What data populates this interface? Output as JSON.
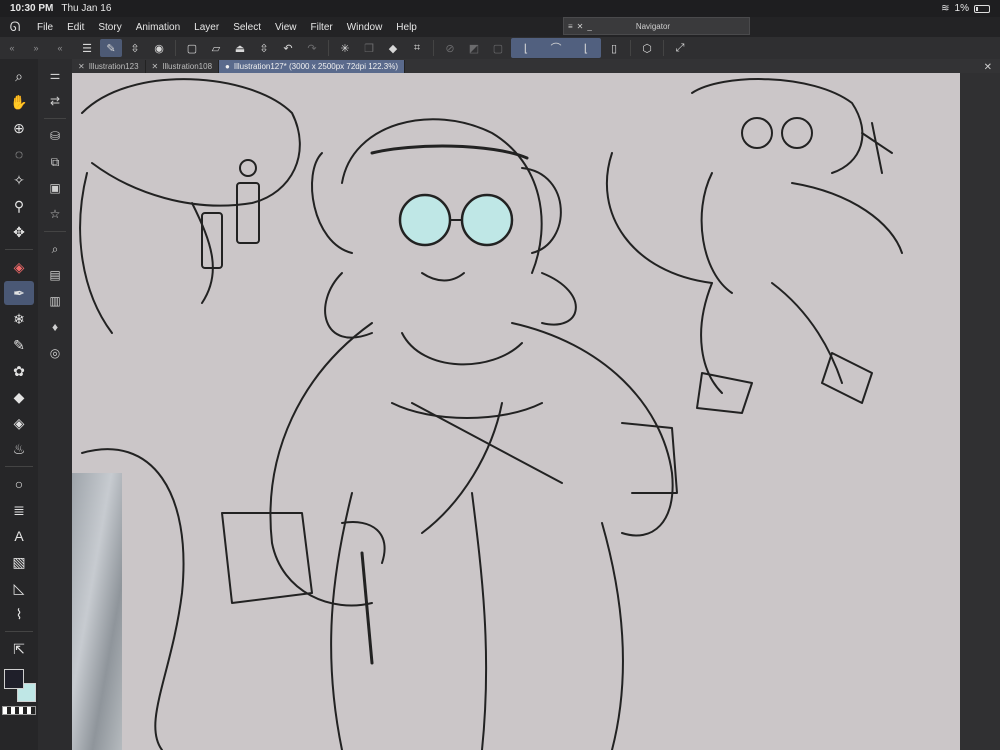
{
  "status": {
    "time": "10:30 PM",
    "date": "Thu Jan 16",
    "battery": "1%"
  },
  "menu": [
    "File",
    "Edit",
    "Story",
    "Animation",
    "Layer",
    "Select",
    "View",
    "Filter",
    "Window",
    "Help"
  ],
  "navigator": {
    "title": "Navigator"
  },
  "tabs": [
    {
      "label": "Illustration123",
      "active": false
    },
    {
      "label": "Illustration108",
      "active": false
    },
    {
      "label": "Illustration127* (3000 x 2500px 72dpi 122.3%)",
      "active": true
    }
  ],
  "colors": {
    "main": "#1f1f2a",
    "sub": "#bfe7e6",
    "accent": "#51607f",
    "canvas": "#cbc6c8"
  },
  "icons": {
    "tools": [
      "magnifier-icon",
      "hand-icon",
      "move-layer-icon",
      "lasso-icon",
      "magic-wand-icon",
      "eyedropper-icon",
      "move-icon",
      "pen-red-icon",
      "pen-icon",
      "snowflake-icon",
      "brush-icon",
      "airbrush-icon",
      "fill-icon",
      "eraser-icon",
      "blend-icon",
      "circle-icon",
      "layers-icon",
      "text-icon",
      "gradient-icon",
      "ruler-icon",
      "shape-icon",
      "select-tool-icon"
    ]
  }
}
